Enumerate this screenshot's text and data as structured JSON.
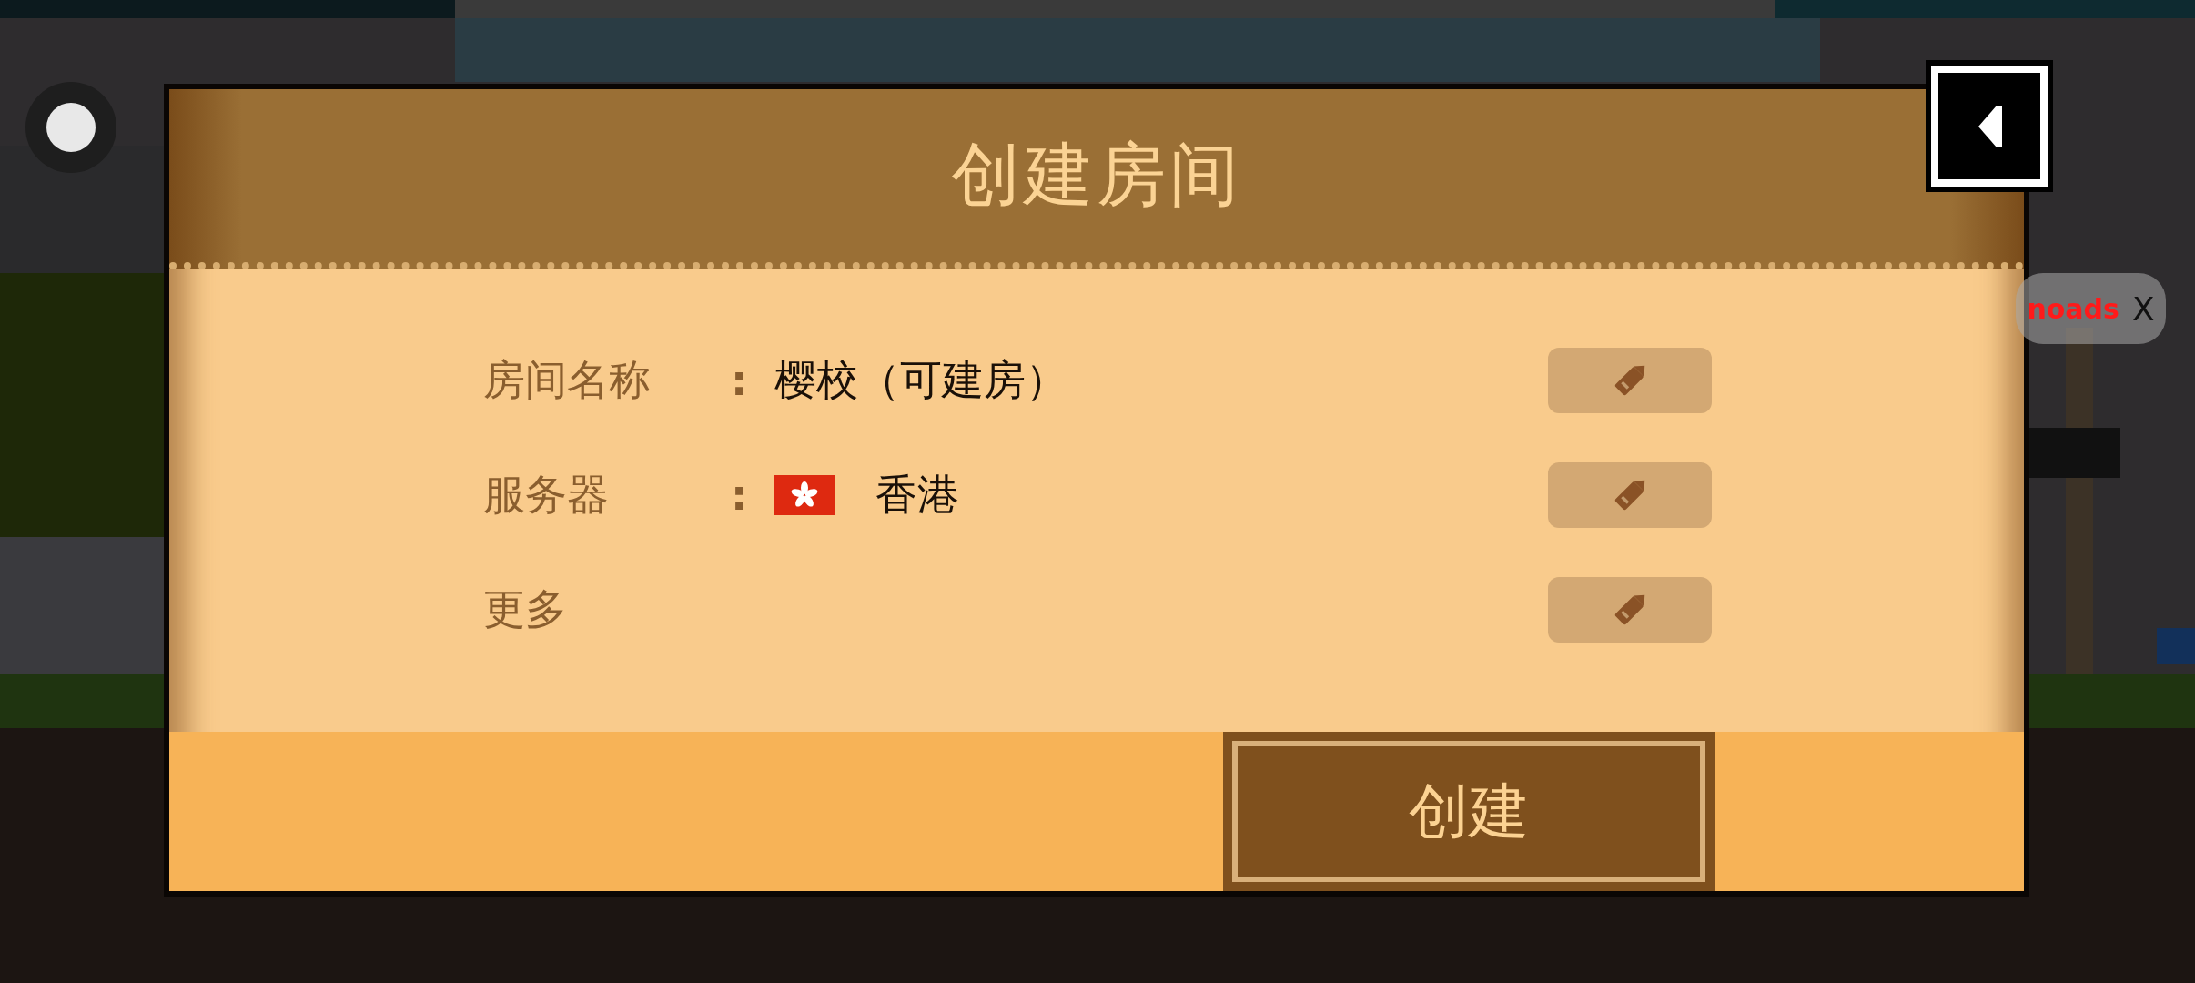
{
  "dialog": {
    "title": "创建房间",
    "fields": [
      {
        "kind": "text",
        "label": "房间名称",
        "separator": ":",
        "value": "樱校（可建房）"
      },
      {
        "kind": "server",
        "label": "服务器",
        "separator": ":",
        "value": "香港"
      },
      {
        "kind": "plain",
        "label": "更多"
      }
    ],
    "create_button": "创建"
  },
  "ad_pill": {
    "label": "noads",
    "close": "X"
  }
}
